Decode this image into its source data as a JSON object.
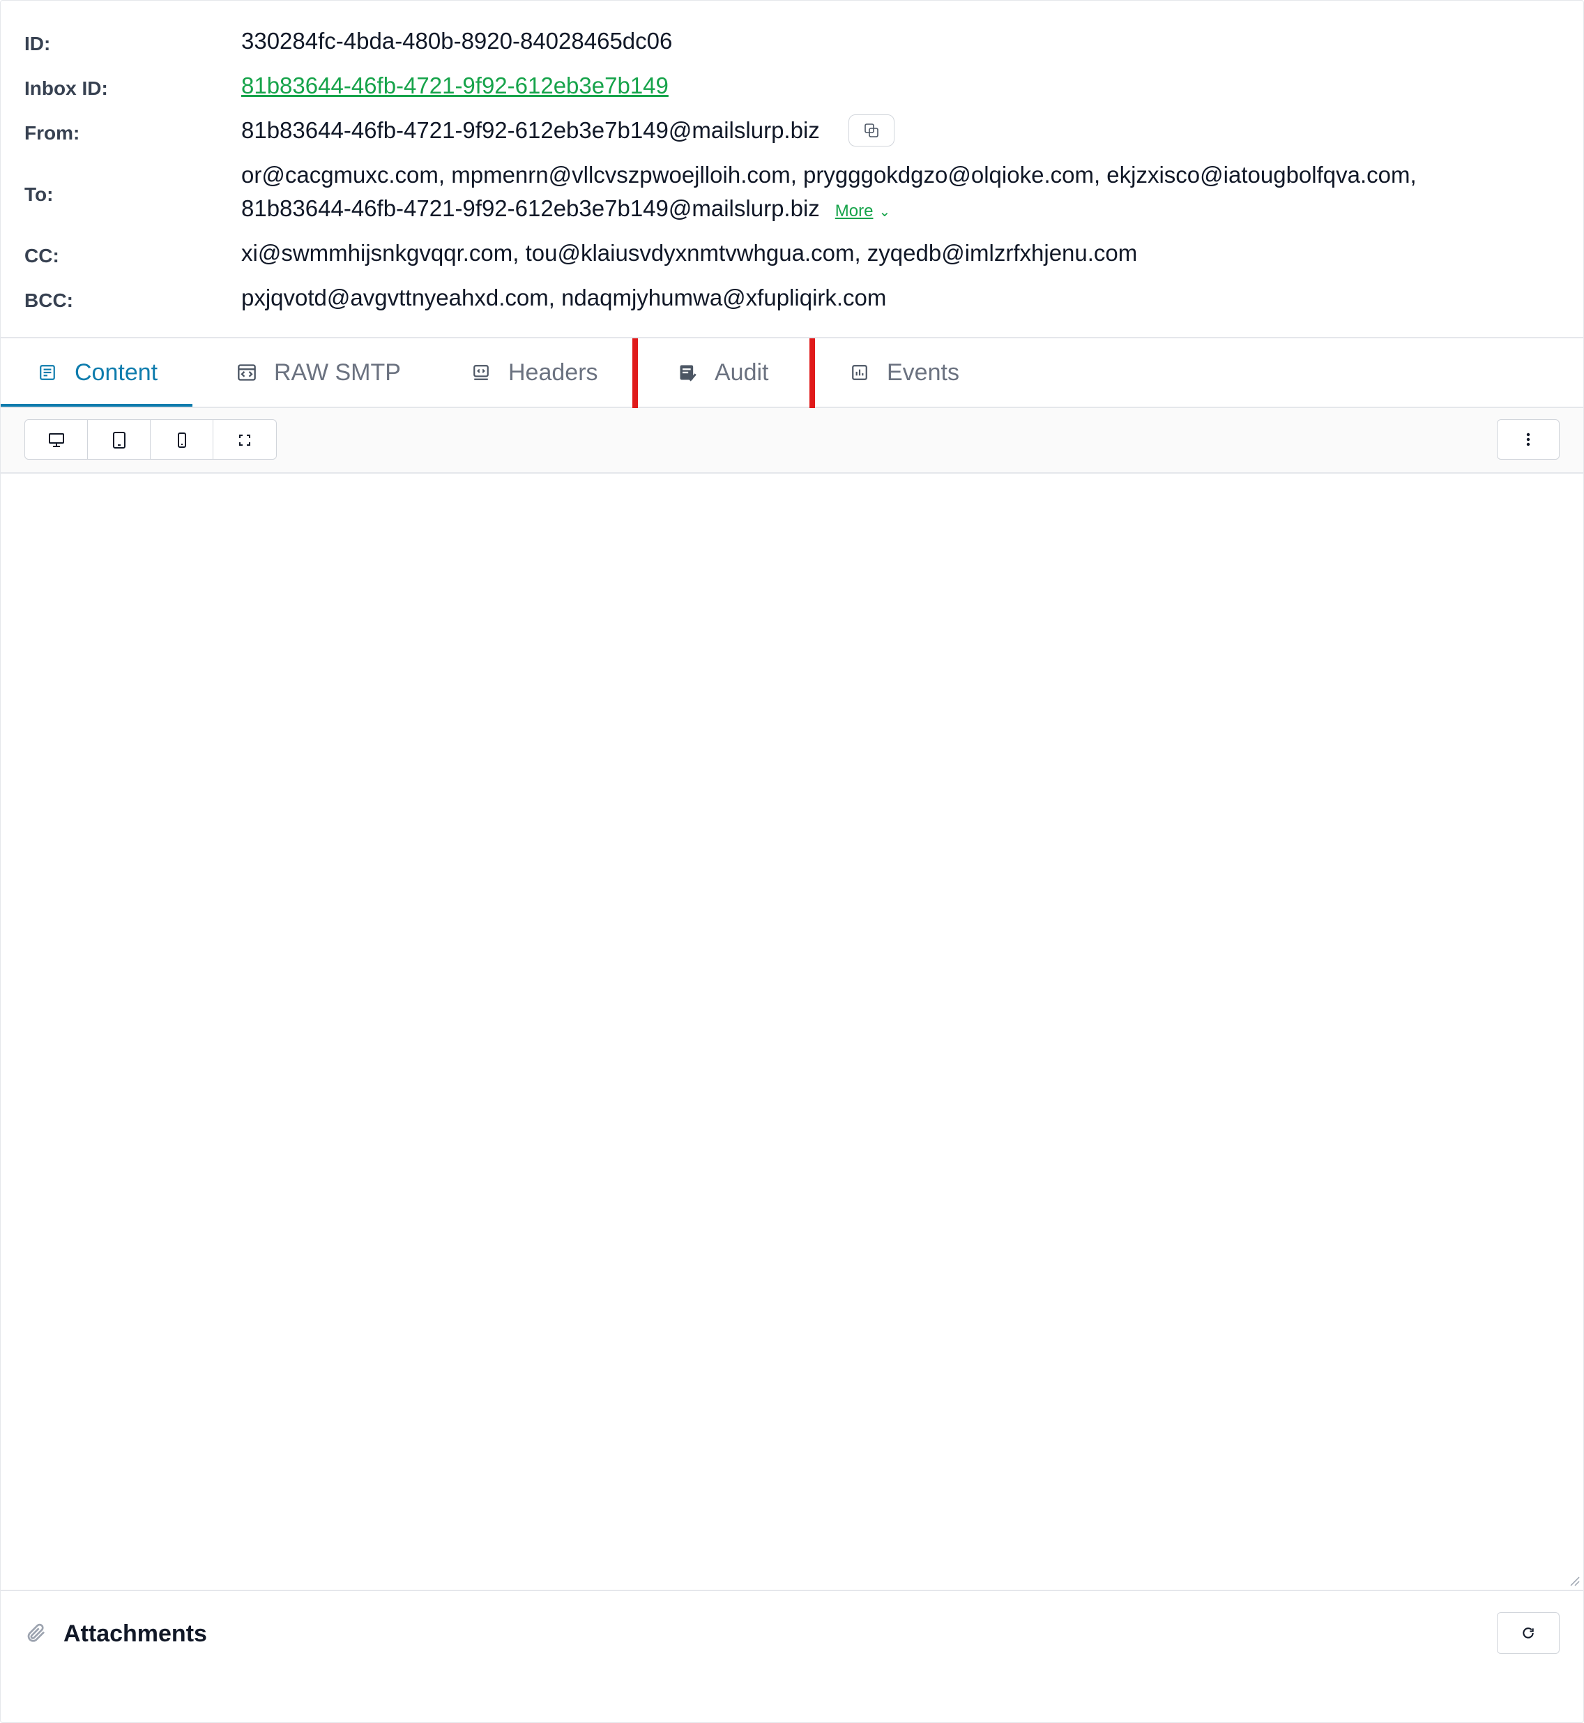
{
  "meta": {
    "id_label": "ID:",
    "id_value": "330284fc-4bda-480b-8920-84028465dc06",
    "inbox_label": "Inbox ID:",
    "inbox_value": "81b83644-46fb-4721-9f92-612eb3e7b149",
    "from_label": "From:",
    "from_value": "81b83644-46fb-4721-9f92-612eb3e7b149@mailslurp.biz",
    "to_label": "To:",
    "to_value": "or@cacgmuxc.com, mpmenrn@vllcvszpwoejlloih.com, prygggokdgzo@olqioke.com, ekjzxisco@iatougbolfqva.com, 81b83644-46fb-4721-9f92-612eb3e7b149@mailslurp.biz",
    "to_more": "More",
    "cc_label": "CC:",
    "cc_value": "xi@swmmhijsnkgvqqr.com, tou@klaiusvdyxnmtvwhgua.com, zyqedb@imlzrfxhjenu.com",
    "bcc_label": "BCC:",
    "bcc_value": "pxjqvotd@avgvttnyeahxd.com, ndaqmjyhumwa@xfupliqirk.com"
  },
  "tabs": [
    {
      "label": "Content",
      "icon": "content-icon",
      "active": true
    },
    {
      "label": "RAW SMTP",
      "icon": "code-window-icon",
      "active": false
    },
    {
      "label": "Headers",
      "icon": "headers-icon",
      "active": false
    },
    {
      "label": "Audit",
      "icon": "audit-icon",
      "active": false
    },
    {
      "label": "Events",
      "icon": "chart-icon",
      "active": false
    }
  ],
  "toolbar": {
    "view_buttons": [
      "desktop-icon",
      "tablet-icon",
      "mobile-icon",
      "fullscreen-icon"
    ],
    "menu_icon": "kebab-icon"
  },
  "attachments": {
    "title": "Attachments",
    "icon": "paperclip-icon",
    "refresh_icon": "refresh-icon"
  },
  "colors": {
    "accent": "#0e7cad",
    "link": "#16a34a",
    "highlight": "#e01a1a"
  }
}
